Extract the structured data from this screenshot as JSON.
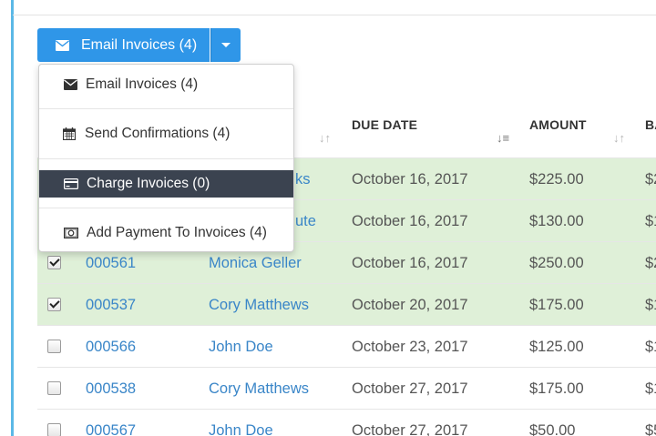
{
  "toolbar": {
    "email_button_label": "Email Invoices (4)"
  },
  "menu": {
    "items": [
      {
        "label": "Email Invoices (4)",
        "icon": "envelope-icon"
      },
      {
        "label": "Send Confirmations (4)",
        "icon": "calendar-icon"
      },
      {
        "label": "Charge Invoices (0)",
        "icon": "credit-card-icon"
      },
      {
        "label": "Add Payment To Invoices (4)",
        "icon": "money-icon"
      }
    ]
  },
  "table": {
    "headers": {
      "due_date": "DUE DATE",
      "amount": "AMOUNT",
      "balance": "BA"
    },
    "sort_icons": [
      "↓↑",
      "↓≡",
      "↓↑"
    ],
    "rows": [
      {
        "checked": true,
        "invoice": "",
        "customer": "ks",
        "due": "October 16, 2017",
        "amount": "$225.00",
        "balance": "$2",
        "selected": true
      },
      {
        "checked": true,
        "invoice": "",
        "customer": "ute",
        "due": "October 16, 2017",
        "amount": "$130.00",
        "balance": "$1",
        "selected": true
      },
      {
        "checked": true,
        "invoice": "000561",
        "customer": "Monica Geller",
        "due": "October 16, 2017",
        "amount": "$250.00",
        "balance": "$2",
        "selected": true
      },
      {
        "checked": true,
        "invoice": "000537",
        "customer": "Cory Matthews",
        "due": "October 20, 2017",
        "amount": "$175.00",
        "balance": "$1",
        "selected": true
      },
      {
        "checked": false,
        "invoice": "000566",
        "customer": "John Doe",
        "due": "October 23, 2017",
        "amount": "$125.00",
        "balance": "$1",
        "selected": false
      },
      {
        "checked": false,
        "invoice": "000538",
        "customer": "Cory Matthews",
        "due": "October 27, 2017",
        "amount": "$175.00",
        "balance": "$1",
        "selected": false
      },
      {
        "checked": false,
        "invoice": "000567",
        "customer": "John Doe",
        "due": "October 27, 2017",
        "amount": "$50.00",
        "balance": "$5",
        "selected": false
      }
    ]
  },
  "colors": {
    "primary": "#2f96e8",
    "selected_row": "#dff0d8",
    "link": "#3a86c8",
    "menu_highlight": "#3b4350"
  }
}
